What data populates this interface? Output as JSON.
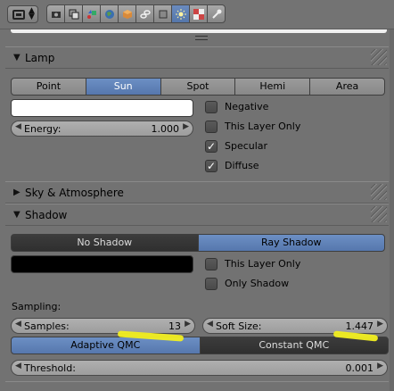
{
  "icons": {
    "editor_type": "properties-editor-icon",
    "context": [
      "render-icon",
      "render-layers-icon",
      "scene-icon",
      "world-icon",
      "object-icon",
      "constraints-icon",
      "data-icon",
      "material-icon",
      "texture-icon",
      "particles-icon"
    ]
  },
  "lamp": {
    "title": "Lamp",
    "types": [
      "Point",
      "Sun",
      "Spot",
      "Hemi",
      "Area"
    ],
    "selected": "Sun",
    "color": "#ffffff",
    "energy_label": "Energy:",
    "energy_value": "1.000",
    "negative": "Negative",
    "this_layer_only": "This Layer Only",
    "specular": "Specular",
    "diffuse": "Diffuse",
    "negative_checked": false,
    "this_layer_only_checked": false,
    "specular_checked": true,
    "diffuse_checked": true
  },
  "sky": {
    "title": "Sky & Atmosphere"
  },
  "shadow": {
    "title": "Shadow",
    "modes": [
      "No Shadow",
      "Ray Shadow"
    ],
    "selected": "Ray Shadow",
    "color": "#000000",
    "this_layer_only": "This Layer Only",
    "only_shadow": "Only Shadow",
    "sampling_label": "Sampling:",
    "samples_label": "Samples:",
    "samples_value": "13",
    "soft_size_label": "Soft Size:",
    "soft_size_value": "1.447",
    "methods": [
      "Adaptive QMC",
      "Constant QMC"
    ],
    "method_selected": "Adaptive QMC",
    "threshold_label": "Threshold:",
    "threshold_value": "0.001"
  },
  "colors": {
    "accent": "#5677ad",
    "highlight": "#f2ef20"
  }
}
